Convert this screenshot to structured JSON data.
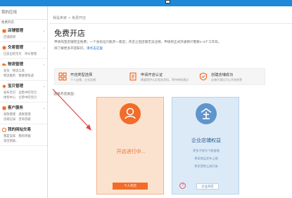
{
  "sidebar": {
    "header": "我的应用",
    "sub": "免费开店",
    "groups": [
      {
        "title": "店铺管理",
        "links": [
          "店铺装修",
          "..."
        ]
      },
      {
        "title": "交易管理",
        "links": [
          "已卖出的宝贝",
          "评价管理"
        ]
      },
      {
        "title": "物流管理",
        "links": [
          "发货",
          "物流工具",
          "物流服务",
          "我要寄快递"
        ]
      },
      {
        "title": "宝贝管理",
        "links": [
          "发布宝贝",
          "出售中的宝贝",
          "体检中心",
          "仓库中的宝贝"
        ]
      },
      {
        "title": "客户服务",
        "links": [
          "退款管理",
          "退款管理",
          "违规记录",
          "咨询答疑"
        ]
      },
      {
        "title": "我的网站交易",
        "links": [
          "我是卖家",
          "我的单据",
          "淘宝帮助..."
        ]
      }
    ]
  },
  "breadcrumb": [
    "我是卖家",
    "免费开店"
  ],
  "page": {
    "title": "免费开店",
    "intro_line1": "申请淘宝店铺完全免费；一个身份证只能开一家店；开店之后店铺无法注销，申请到正式开通预计需要1~3个工作日。",
    "intro_line2_prefix": "除了解更多开店知识，",
    "intro_line2_link": "请点击这里",
    "choose_label": "选择开店类型："
  },
  "steps": [
    {
      "title": "开店类型选择",
      "desc": "个人店铺、企业店铺"
    },
    {
      "title": "申请开店认证",
      "desc": "需要提供认证相关资料，等待审核通过"
    },
    {
      "title": "创建店铺成功",
      "desc": "店铺开通后可以开始经营"
    }
  ],
  "card_personal": {
    "status": "开店进行中...",
    "button": "个人开店"
  },
  "card_enterprise": {
    "title": "企业店铺权益",
    "rows": [
      "更多子账号个数管理",
      "更高商品发布上限",
      "更多营销工具开放"
    ],
    "button": "企业开店",
    "help": "?"
  },
  "colors": {
    "topbar": "#1e88d9",
    "accent_orange": "#f26c2a",
    "accent_blue": "#5f95cc",
    "arrow": "#e04848"
  }
}
